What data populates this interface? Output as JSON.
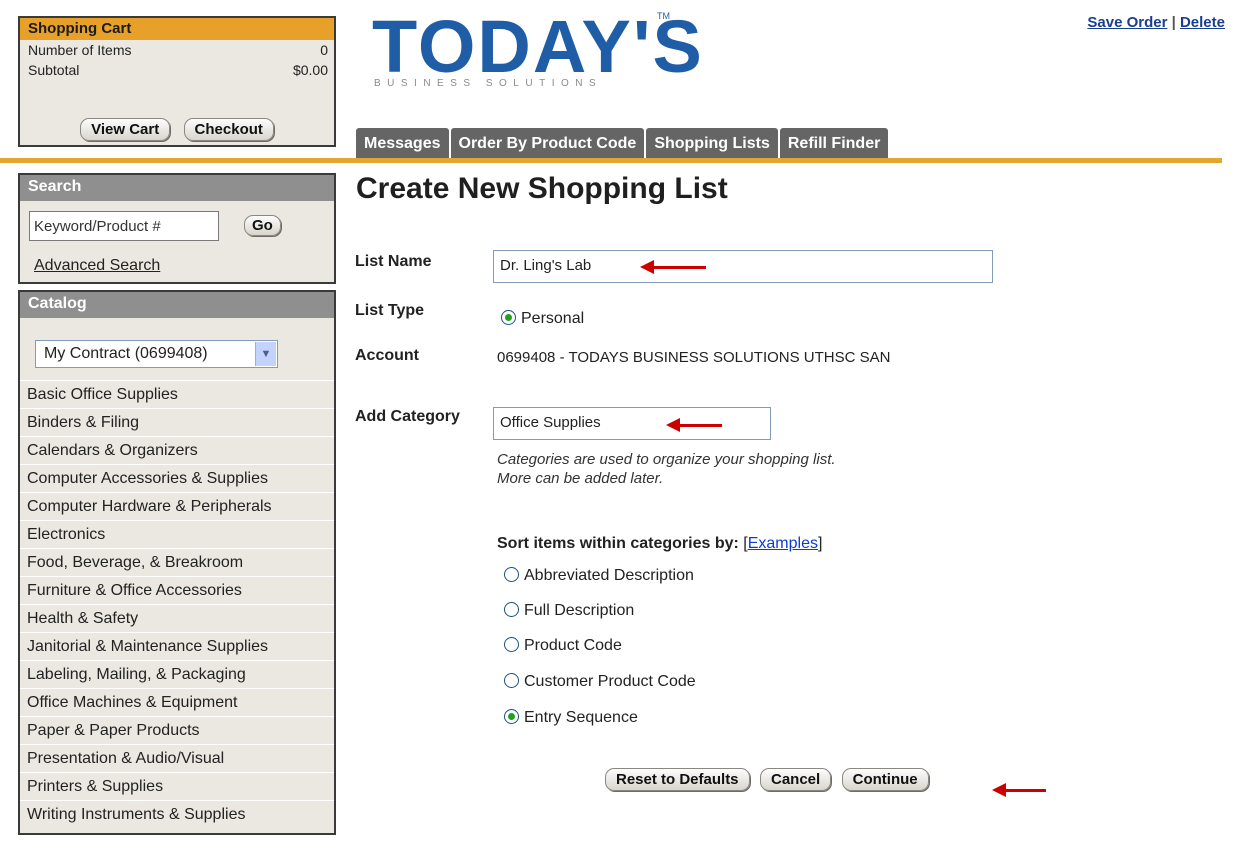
{
  "cart": {
    "title": "Shopping Cart",
    "items_label": "Number of Items",
    "items_value": "0",
    "subtotal_label": "Subtotal",
    "subtotal_value": "$0.00",
    "view_cart": "View Cart",
    "checkout": "Checkout"
  },
  "logo": {
    "name": "TODAY'S",
    "tm": "TM",
    "tagline": "BUSINESS SOLUTIONS"
  },
  "top_links": {
    "save_order": "Save Order",
    "separator": "|",
    "delete": "Delete"
  },
  "tabs": [
    "Messages",
    "Order By Product Code",
    "Shopping Lists",
    "Refill Finder"
  ],
  "search": {
    "title": "Search",
    "value": "Keyword/Product #",
    "go": "Go",
    "advanced": "Advanced Search"
  },
  "catalog": {
    "title": "Catalog",
    "selected": "My Contract (0699408)",
    "items": [
      "Basic Office Supplies",
      "Binders & Filing",
      "Calendars & Organizers",
      "Computer Accessories & Supplies",
      "Computer Hardware & Peripherals",
      "Electronics",
      "Food, Beverage, & Breakroom",
      "Furniture & Office Accessories",
      "Health & Safety",
      "Janitorial & Maintenance Supplies",
      "Labeling, Mailing, & Packaging",
      "Office Machines & Equipment",
      "Paper & Paper Products",
      "Presentation & Audio/Visual",
      "Printers & Supplies",
      "Writing Instruments & Supplies"
    ]
  },
  "form": {
    "heading": "Create New Shopping List",
    "list_name_label": "List Name",
    "list_name_value": "Dr. Ling's Lab",
    "list_type_label": "List Type",
    "list_type_option": "Personal",
    "account_label": "Account",
    "account_value": "0699408 - TODAYS BUSINESS SOLUTIONS UTHSC SAN",
    "category_label": "Add Category",
    "category_value": "Office Supplies",
    "hint_line1": "Categories are used to organize your shopping list.",
    "hint_line2": "More can be added later.",
    "sort_label": "Sort items within categories by:",
    "examples_link": "Examples",
    "bracket_open": "[",
    "bracket_close": "]",
    "sort_options": [
      "Abbreviated Description",
      "Full Description",
      "Product Code",
      "Customer Product Code",
      "Entry Sequence"
    ],
    "sort_selected": "Entry Sequence",
    "buttons": {
      "reset": "Reset to Defaults",
      "cancel": "Cancel",
      "continue": "Continue"
    }
  },
  "colors": {
    "brand_blue": "#1f5da7",
    "accent_gold": "#e1a731",
    "tab_gray": "#656565",
    "arrow_red": "#cc0000",
    "radio_green": "#21a121"
  }
}
